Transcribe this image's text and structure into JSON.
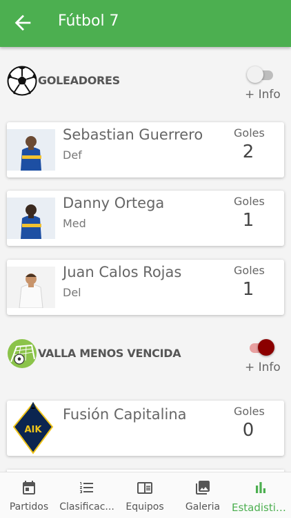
{
  "appbar": {
    "title": "Fútbol 7",
    "back_icon": "arrow-left-icon"
  },
  "colors": {
    "primary": "#4caf50",
    "toggle_off": "#bdbdbd",
    "toggle_on": "#8b0000"
  },
  "sections": {
    "scorers": {
      "label": "GOLEADORES",
      "icon": "soccer-ball-icon",
      "toggle_on": false,
      "more": "+ Info",
      "rows": [
        {
          "name": "Sebastian Guerrero",
          "position": "Def",
          "stat_label": "Goles",
          "value": "2"
        },
        {
          "name": "Danny Ortega",
          "position": "Med",
          "stat_label": "Goles",
          "value": "1"
        },
        {
          "name": "Juan Calos Rojas",
          "position": "Del",
          "stat_label": "Goles",
          "value": "1"
        }
      ]
    },
    "defense": {
      "label": "VALLA MENOS VENCIDA",
      "icon": "goal-net-icon",
      "toggle_on": true,
      "more": "+ Info",
      "rows": [
        {
          "name": "Fusión Capitalina",
          "stat_label": "Goles",
          "value": "0",
          "crest_text": "AIK"
        }
      ]
    }
  },
  "bottom_nav": [
    {
      "label": "Partidos",
      "icon": "calendar-icon",
      "active": false
    },
    {
      "label": "Clasificac...",
      "icon": "ranked-list-icon",
      "active": false
    },
    {
      "label": "Equipos",
      "icon": "book-icon",
      "active": false
    },
    {
      "label": "Galeria",
      "icon": "image-gallery-icon",
      "active": false
    },
    {
      "label": "Estadistic...",
      "icon": "bar-chart-icon",
      "active": true
    }
  ]
}
